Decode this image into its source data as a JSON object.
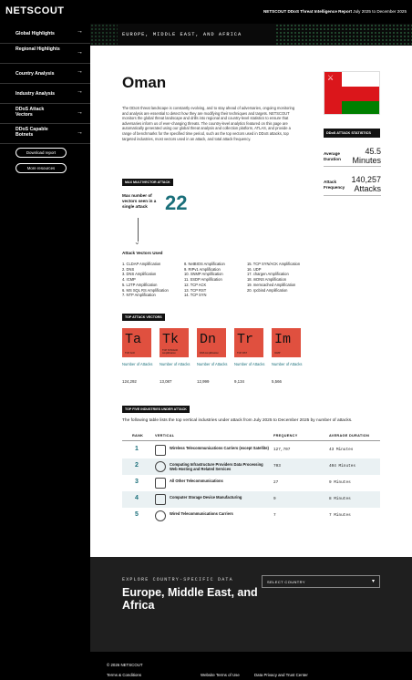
{
  "header": {
    "logo": "NETSCOUT",
    "report_brand": "NETSCOUT DDoS Threat Intelligence Report",
    "report_period": "July 2025 to December 2025"
  },
  "sidebar": {
    "items": [
      {
        "label": "Global Highlights"
      },
      {
        "label": "Regional Highlights"
      },
      {
        "label": "Country Analysis"
      },
      {
        "label": "Industry Analysis"
      },
      {
        "label": "DDoS Attack Vectors"
      },
      {
        "label": "DDoS Capable Botnets"
      }
    ],
    "download_label": "Download report",
    "more_label": "More resources"
  },
  "hero": {
    "region": "EUROPE, MIDDLE EAST, AND AFRICA"
  },
  "country": {
    "name": "Oman",
    "intro": "The DDoS threat landscape is constantly evolving, and to stay ahead of adversaries, ongoing monitoring and analysis are essential to detect how they are modifying their techniques and targets. NETSCOUT monitors the global threat landscape and drills into regional and country-level statistics to ensure that adversaries inform us of ever-changing threats. The country-level analytics featured on this page are automatically generated using our global threat analysis and collection platform, ATLAS, and provide a range of benchmarks for the specified time period, such as the top vectors used in DDoS attacks, top targeted industries, most vectors used in an attack, and total attack frequency."
  },
  "stats": {
    "title": "DDoS ATTACK STATISTICS",
    "avg_label": "Average Duration",
    "avg_value": "45.5 Minutes",
    "freq_label": "Attack Frequency",
    "freq_value": "140,257 Attacks"
  },
  "max_multivector": {
    "tag": "MAX MULTIVECTOR ATTACK",
    "label": "Max number of vectors seen in a single attack",
    "value": "22"
  },
  "vectors": {
    "title": "Attack Vectors Used",
    "columns": [
      [
        "1. CLDAP Amplification",
        "2. DNS",
        "3. DNS Amplification",
        "4. ICMP",
        "5. L2TP Amplification",
        "6. MS SQL RS Amplification",
        "7. NTP Amplification"
      ],
      [
        "8. NetBIOS Amplification",
        "9. RIPv1 Amplification",
        "10. SNMP Amplification",
        "11. SSDP Amplification",
        "12. TCP ACK",
        "13. TCP RST",
        "14. TCP SYN"
      ],
      [
        "15. TCP SYN/ACK Amplification",
        "16. UDP",
        "17. chargen Amplification",
        "18. mDNS Amplification",
        "19. memcached Amplification",
        "20. rpcbind Amplification"
      ]
    ]
  },
  "top_vectors": {
    "tag": "TOP ATTACK VECTORS",
    "caption": "Number of Attacks",
    "tiles": [
      {
        "symbol": "Ta",
        "sub": "TCP ACK",
        "count": "124,292"
      },
      {
        "symbol": "Tk",
        "sub": "TCP SYN/ACK Amplification",
        "count": "13,087"
      },
      {
        "symbol": "Dn",
        "sub": "DNS Amplification",
        "count": "12,999"
      },
      {
        "symbol": "Tr",
        "sub": "TCP RST",
        "count": "9,134"
      },
      {
        "symbol": "Im",
        "sub": "ICMP",
        "count": "5,566"
      }
    ]
  },
  "industries": {
    "tag": "TOP FIVE INDUSTRIES UNDER ATTACK",
    "intro": "The following table lists the top vertical industries under attack from July 2025 to December 2025 by number of attacks.",
    "columns": {
      "rank": "RANK",
      "vertical": "VERTICAL",
      "frequency": "FREQUENCY",
      "duration": "AVERAGE DURATION"
    },
    "rows": [
      {
        "rank": "1",
        "icon": "phone-icon",
        "name": "Wireless Telecommunications Carriers (except Satellite)",
        "frequency": "127,707",
        "duration": "43 Minutes"
      },
      {
        "rank": "2",
        "icon": "cloud-icon",
        "name": "Computing Infrastructure Providers Data Processing Web Hosting and Related Services",
        "frequency": "703",
        "duration": "404 Minutes"
      },
      {
        "rank": "3",
        "icon": "network-icon",
        "name": "All Other Telecommunications",
        "frequency": "27",
        "duration": "9 Minutes"
      },
      {
        "rank": "4",
        "icon": "storage-icon",
        "name": "Computer Storage Device Manufacturing",
        "frequency": "9",
        "duration": "8 Minutes"
      },
      {
        "rank": "5",
        "icon": "signal-icon",
        "name": "Wired Telecommunications Carriers",
        "frequency": "7",
        "duration": "7 Minutes"
      }
    ]
  },
  "explore": {
    "kicker": "EXPLORE COUNTRY-SPECIFIC DATA",
    "title": "Europe, Middle East, and Africa",
    "select_placeholder": "SELECT COUNTRY"
  },
  "footer": {
    "copyright": "© 2026 NETSCOUT",
    "links": [
      "Terms & Conditions",
      "Website Terms of Use",
      "Data Privacy and Trust Center"
    ]
  },
  "colors": {
    "accent": "#1a6f7a",
    "tile": "#e0503f",
    "sidebar": "#000000",
    "band": "#1f1f1f"
  }
}
